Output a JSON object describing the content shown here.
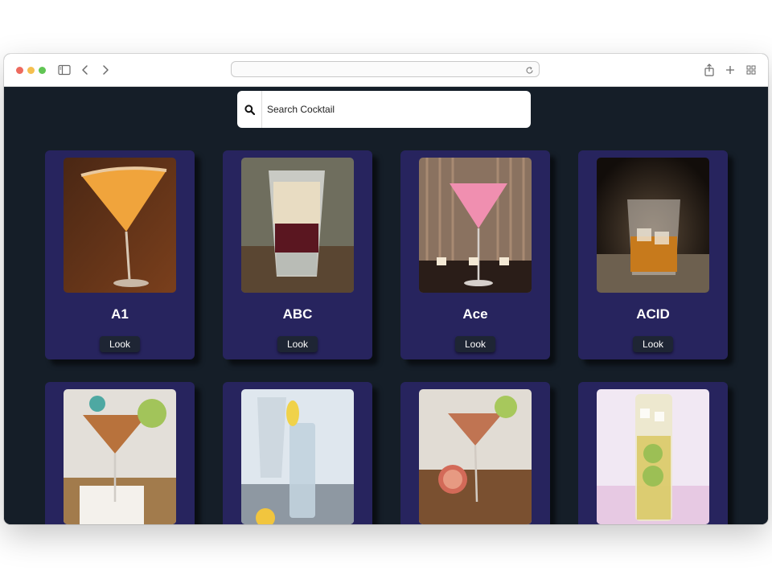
{
  "search": {
    "placeholder": "Search Cocktail"
  },
  "drinks": [
    {
      "name": "A1",
      "button": "Look"
    },
    {
      "name": "ABC",
      "button": "Look"
    },
    {
      "name": "Ace",
      "button": "Look"
    },
    {
      "name": "ACID",
      "button": "Look"
    },
    {
      "name": "",
      "button": ""
    },
    {
      "name": "",
      "button": ""
    },
    {
      "name": "",
      "button": ""
    },
    {
      "name": "",
      "button": ""
    }
  ],
  "colors": {
    "page_background": "#151e28",
    "card_background": "#27245e",
    "button_background": "#1e2534",
    "title_text": "#ffffff"
  },
  "icons": [
    "sidebar-icon",
    "back-chevron-icon",
    "forward-chevron-icon",
    "reload-icon",
    "share-icon",
    "new-tab-icon",
    "tab-overview-icon",
    "search-icon"
  ]
}
